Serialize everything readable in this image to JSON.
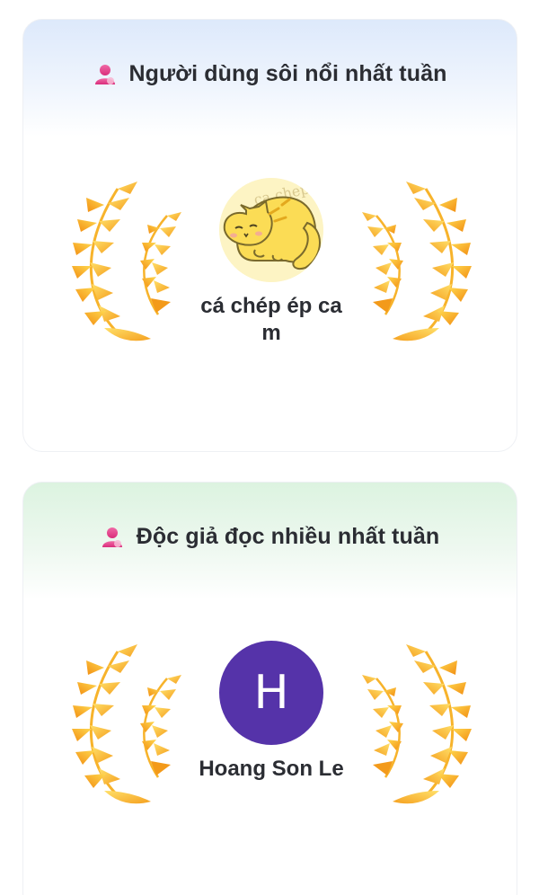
{
  "sections": [
    {
      "title": "Người dùng sôi nổi nhất tuần",
      "user_name": "cá chép ép cam",
      "avatar_type": "cat-illustration",
      "avatar_watermark": "ca chep ep cam"
    },
    {
      "title": "Độc giả đọc nhiều nhất tuần",
      "user_name": "Hoang Son Le",
      "avatar_type": "letter",
      "avatar_letter": "H"
    }
  ],
  "icons": {
    "section_icon": "user-icon",
    "wreath": "laurel-wreath-icon"
  },
  "colors": {
    "active_header_tint": "#dde9fb",
    "reader_header_tint": "#dcf3e0",
    "avatar_letter_bg": "#5533a9",
    "wreath_light": "#ffd54a",
    "wreath_dark": "#f59a1b",
    "user_icon": "#e8418a"
  }
}
